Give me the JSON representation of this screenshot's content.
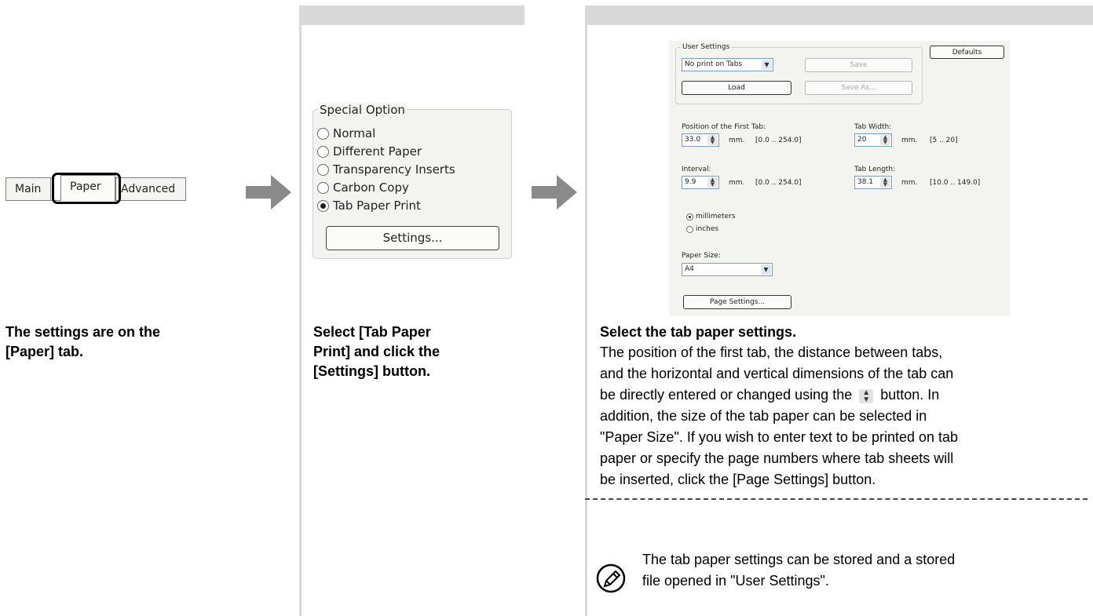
{
  "step1": {
    "tabs": [
      "Main",
      "Paper",
      "Advanced"
    ],
    "caption": [
      "The settings are on the",
      "[Paper] tab."
    ]
  },
  "step2": {
    "group_label": "Special Option",
    "options": [
      "Normal",
      "Different Paper",
      "Transparency Inserts",
      "Carbon Copy",
      "Tab Paper Print"
    ],
    "selected": "Tab Paper Print",
    "settings_button": "Settings...",
    "caption": [
      "Select [Tab Paper",
      "Print] and click the",
      "[Settings] button."
    ]
  },
  "step3": {
    "dialog": {
      "user_settings_label": "User Settings",
      "user_settings_value": "No print on Tabs",
      "save": "Save",
      "save_as": "Save As...",
      "load": "Load",
      "defaults": "Defaults",
      "first_tab_label": "Position of the First Tab:",
      "first_tab_value": "33.0",
      "first_tab_unit": "mm.",
      "first_tab_range": "[0.0 .. 254.0]",
      "tab_width_label": "Tab Width:",
      "tab_width_value": "20",
      "tab_width_unit": "mm.",
      "tab_width_range": "[5 .. 20]",
      "interval_label": "Interval:",
      "interval_value": "9.9",
      "interval_unit": "mm.",
      "interval_range": "[0.0 .. 254.0]",
      "tab_length_label": "Tab Length:",
      "tab_length_value": "38.1",
      "tab_length_unit": "mm.",
      "tab_length_range": "[10.0 .. 149.0]",
      "unit_millimeters": "millimeters",
      "unit_inches": "inches",
      "paper_size_label": "Paper Size:",
      "paper_size_value": "A4",
      "page_settings": "Page Settings..."
    },
    "heading": "Select the tab paper settings.",
    "body_lines": [
      "The position of the first tab, the distance between tabs,",
      "and the horizontal and vertical dimensions of the tab can",
      "be directly entered or changed using the",
      "button. In",
      "addition, the size of the tab paper can be selected in",
      "\"Paper Size\". If you wish to enter text to be printed on tab",
      "paper or specify the page numbers where tab sheets will",
      "be inserted, click the [Page Settings] button."
    ],
    "note_lines": [
      "The tab paper settings can be stored and a stored",
      "file opened in \"User Settings\"."
    ]
  }
}
